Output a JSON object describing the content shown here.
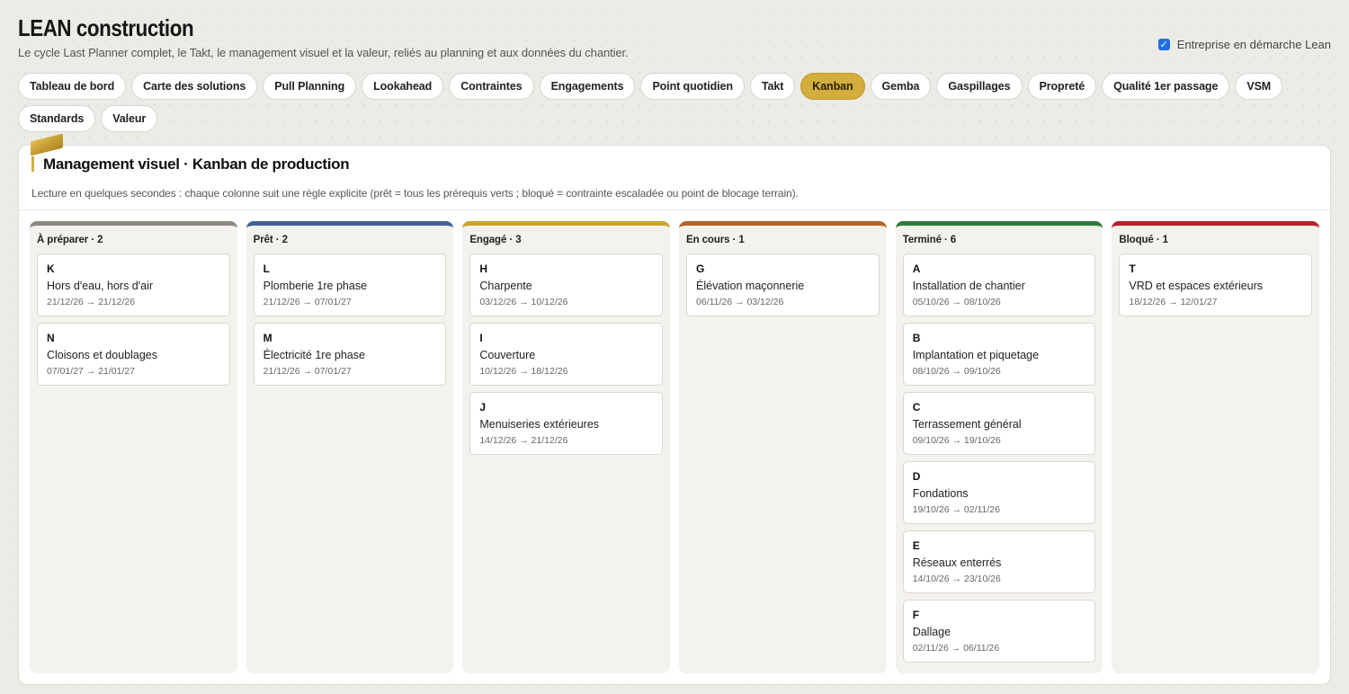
{
  "header": {
    "title": "LEAN construction",
    "subtitle": "Le cycle Last Planner complet, le Takt, le management visuel et la valeur, reliés au planning et aux données du chantier.",
    "lean_toggle_label": "Entreprise en démarche Lean",
    "lean_toggle_checked": true
  },
  "tabs": [
    {
      "label": "Tableau de bord",
      "active": false
    },
    {
      "label": "Carte des solutions",
      "active": false
    },
    {
      "label": "Pull Planning",
      "active": false
    },
    {
      "label": "Lookahead",
      "active": false
    },
    {
      "label": "Contraintes",
      "active": false
    },
    {
      "label": "Engagements",
      "active": false
    },
    {
      "label": "Point quotidien",
      "active": false
    },
    {
      "label": "Takt",
      "active": false
    },
    {
      "label": "Kanban",
      "active": true
    },
    {
      "label": "Gemba",
      "active": false
    },
    {
      "label": "Gaspillages",
      "active": false
    },
    {
      "label": "Propreté",
      "active": false
    },
    {
      "label": "Qualité 1er passage",
      "active": false
    },
    {
      "label": "VSM",
      "active": false
    },
    {
      "label": "Standards",
      "active": false
    },
    {
      "label": "Valeur",
      "active": false
    }
  ],
  "panel": {
    "title": "Management visuel · Kanban de production",
    "description": "Lecture en quelques secondes : chaque colonne suit une règle explicite (prêt = tous les prérequis verts ; bloqué = contrainte escaladée ou point de blocage terrain)."
  },
  "colors": {
    "accent": "#d3ad3e",
    "checkbox": "#1f6fe0"
  },
  "columns": [
    {
      "title": "À préparer · 2",
      "color": "#8c8a80",
      "cards": [
        {
          "code": "K",
          "name": "Hors d'eau, hors d'air",
          "dates": "21/12/26 → 21/12/26"
        },
        {
          "code": "N",
          "name": "Cloisons et doublages",
          "dates": "07/01/27 → 21/01/27"
        }
      ]
    },
    {
      "title": "Prêt · 2",
      "color": "#3f6196",
      "cards": [
        {
          "code": "L",
          "name": "Plomberie 1re phase",
          "dates": "21/12/26 → 07/01/27"
        },
        {
          "code": "M",
          "name": "Électricité 1re phase",
          "dates": "21/12/26 → 07/01/27"
        }
      ]
    },
    {
      "title": "Engagé · 3",
      "color": "#c9a431",
      "cards": [
        {
          "code": "H",
          "name": "Charpente",
          "dates": "03/12/26 → 10/12/26"
        },
        {
          "code": "I",
          "name": "Couverture",
          "dates": "10/12/26 → 18/12/26"
        },
        {
          "code": "J",
          "name": "Menuiseries extérieures",
          "dates": "14/12/26 → 21/12/26"
        }
      ]
    },
    {
      "title": "En cours · 1",
      "color": "#b5652a",
      "cards": [
        {
          "code": "G",
          "name": "Élévation maçonnerie",
          "dates": "06/11/26 → 03/12/26"
        }
      ]
    },
    {
      "title": "Terminé · 6",
      "color": "#2e7b3b",
      "cards": [
        {
          "code": "A",
          "name": "Installation de chantier",
          "dates": "05/10/26 → 08/10/26"
        },
        {
          "code": "B",
          "name": "Implantation et piquetage",
          "dates": "08/10/26 → 09/10/26"
        },
        {
          "code": "C",
          "name": "Terrassement général",
          "dates": "09/10/26 → 19/10/26"
        },
        {
          "code": "D",
          "name": "Fondations",
          "dates": "19/10/26 → 02/11/26"
        },
        {
          "code": "E",
          "name": "Réseaux enterrés",
          "dates": "14/10/26 → 23/10/26"
        },
        {
          "code": "F",
          "name": "Dallage",
          "dates": "02/11/26 → 06/11/26"
        }
      ]
    },
    {
      "title": "Bloqué · 1",
      "color": "#b5232b",
      "cards": [
        {
          "code": "T",
          "name": "VRD et espaces extérieurs",
          "dates": "18/12/26 → 12/01/27"
        }
      ]
    }
  ]
}
